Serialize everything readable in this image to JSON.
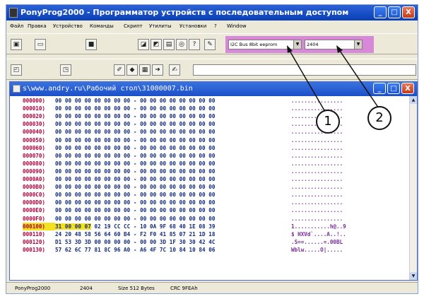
{
  "window": {
    "title": "PonyProg2000 - Программатор устройств с последовательным доступом",
    "buttons": [
      "_",
      "□",
      "X"
    ]
  },
  "menu": [
    "Файл",
    "Правка",
    "Устройство",
    "Команды",
    "Скрипт",
    "Утилиты",
    "Установки",
    "?",
    "Window"
  ],
  "toolbar1": {
    "device_family": "I2C Bus 8bit eeprom",
    "device_type": "2404"
  },
  "child": {
    "title": "s\\www.andry.ru\\Рабочий стол\\31000007.bin"
  },
  "hex_rows": [
    {
      "addr": "000000)",
      "bytes": "00 00 00 00 00 00 00 00 - 00 00 00 00 00 00 00 00",
      "ascii": "................"
    },
    {
      "addr": "000010)",
      "bytes": "00 00 00 00 00 00 00 00 - 00 00 00 00 00 00 00 00",
      "ascii": "................"
    },
    {
      "addr": "000020)",
      "bytes": "00 00 00 00 00 00 00 00 - 00 00 00 00 00 00 00 00",
      "ascii": "................"
    },
    {
      "addr": "000030)",
      "bytes": "00 00 00 00 00 00 00 00 - 00 00 00 00 00 00 00 00",
      "ascii": "................"
    },
    {
      "addr": "000040)",
      "bytes": "00 00 00 00 00 00 00 00 - 00 00 00 00 00 00 00 00",
      "ascii": "................"
    },
    {
      "addr": "000050)",
      "bytes": "00 00 00 00 00 00 00 00 - 00 00 00 00 00 00 00 00",
      "ascii": "................"
    },
    {
      "addr": "000060)",
      "bytes": "00 00 00 00 00 00 00 00 - 00 00 00 00 00 00 00 00",
      "ascii": "................"
    },
    {
      "addr": "000070)",
      "bytes": "00 00 00 00 00 00 00 00 - 00 00 00 00 00 00 00 00",
      "ascii": "................"
    },
    {
      "addr": "000080)",
      "bytes": "00 00 00 00 00 00 00 00 - 00 00 00 00 00 00 00 00",
      "ascii": "................"
    },
    {
      "addr": "000090)",
      "bytes": "00 00 00 00 00 00 00 00 - 00 00 00 00 00 00 00 00",
      "ascii": "................"
    },
    {
      "addr": "0000A0)",
      "bytes": "00 00 00 00 00 00 00 00 - 00 00 00 00 00 00 00 00",
      "ascii": "................"
    },
    {
      "addr": "0000B0)",
      "bytes": "00 00 00 00 00 00 00 00 - 00 00 00 00 00 00 00 00",
      "ascii": "................"
    },
    {
      "addr": "0000C0)",
      "bytes": "00 00 00 00 00 00 00 00 - 00 00 00 00 00 00 00 00",
      "ascii": "................"
    },
    {
      "addr": "0000D0)",
      "bytes": "00 00 00 00 00 00 00 00 - 00 00 00 00 00 00 00 00",
      "ascii": "................"
    },
    {
      "addr": "0000E0)",
      "bytes": "00 00 00 00 00 00 00 00 - 00 00 00 00 00 00 00 00",
      "ascii": "................"
    },
    {
      "addr": "0000F0)",
      "bytes": "00 00 00 00 00 00 00 00 - 00 00 00 00 00 00 00 00",
      "ascii": "................"
    },
    {
      "addr": "000100)",
      "bytes": "31 00 00 07 02 19 CC CC - 10 0A 9F 68 40 1E 08 39",
      "ascii": "1...........h@..9",
      "highlight": "31 00 00 07"
    },
    {
      "addr": "000110)",
      "bytes": "24 20 48 58 56 64 60 B4 - F2 F0 41 85 07 21 1D 18",
      "ascii": "$ HXVd`....A..!.."
    },
    {
      "addr": "000120)",
      "bytes": "D1 53 3D 3D 00 00 00 00 - 00 00 3D 1F 30 30 42 4C",
      "ascii": ".S==......=.00BL"
    },
    {
      "addr": "000130)",
      "bytes": "57 62 6C 77 81 8C 96 A0 - A6 4F 7C 10 84 10 84 06",
      "ascii": "Wblw.....O|....."
    }
  ],
  "status": {
    "app": "PonyProg2000",
    "device": "2404",
    "size": "Size  512 Bytes",
    "crc": "CRC  9FEAh"
  },
  "callouts": [
    "1",
    "2"
  ]
}
